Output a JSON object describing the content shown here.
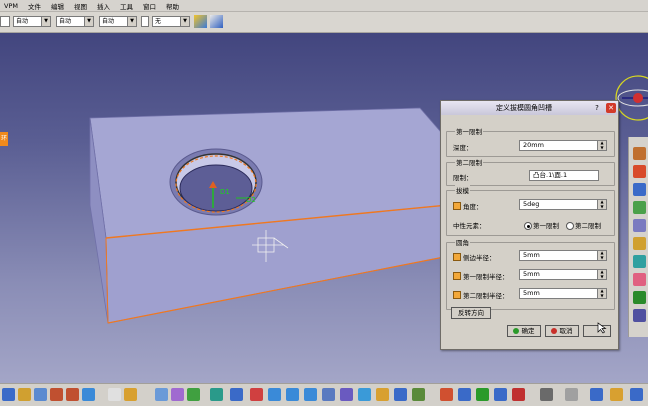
{
  "menu": [
    "VPM",
    "文件",
    "编辑",
    "视图",
    "插入",
    "工具",
    "窗口",
    "帮助"
  ],
  "toolbar": {
    "combo1": "",
    "combo2": "自动",
    "combo3": "自动",
    "combo4": "自动",
    "combo5": "无"
  },
  "left_tab": "环",
  "dialog": {
    "title": "定义拔模圆角凹槽",
    "help": "?",
    "close": "✕",
    "first_limit": {
      "label": "第一限制",
      "depth_label": "深度：",
      "depth_value": "20mm"
    },
    "second_limit": {
      "label": "第二限制",
      "limit_label": "限制：",
      "limit_value": "凸台.1\\面.1"
    },
    "draft": {
      "label": "拔模",
      "angle_label": "角度：",
      "angle_value": "5deg",
      "neutral_label": "中性元素：",
      "radio1": "第一限制",
      "radio2": "第二限制",
      "selected": "第一限制"
    },
    "fillets": {
      "label": "圆角",
      "side_label": "侧边半径：",
      "side_value": "5mm",
      "first_label": "第一限制半径：",
      "first_value": "5mm",
      "second_label": "第二限制半径：",
      "second_value": "5mm"
    },
    "reverse_button": "反转方向",
    "ok_button": "确定",
    "cancel_button": "取消",
    "preview_button": ""
  },
  "colors": {
    "background_top": "#3b3e78",
    "background_bottom": "#a9abcb",
    "part_face": "#a9a9d6",
    "highlight_edge": "#f07820",
    "dialog_bg": "#d4d0c8",
    "ok_green": "#2a9a2a",
    "cancel_red": "#c8302a"
  }
}
